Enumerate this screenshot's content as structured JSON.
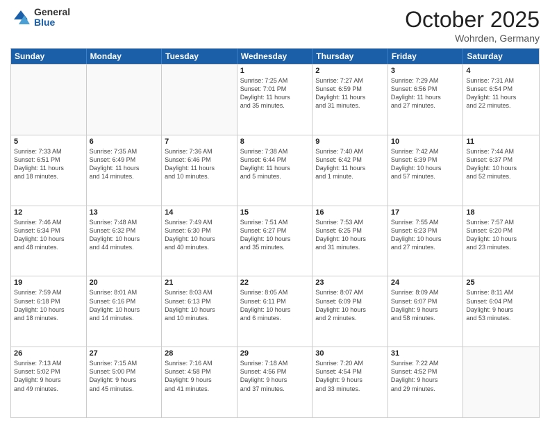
{
  "logo": {
    "general": "General",
    "blue": "Blue"
  },
  "header": {
    "month": "October 2025",
    "location": "Wohrden, Germany"
  },
  "weekdays": [
    "Sunday",
    "Monday",
    "Tuesday",
    "Wednesday",
    "Thursday",
    "Friday",
    "Saturday"
  ],
  "rows": [
    [
      {
        "day": "",
        "info": ""
      },
      {
        "day": "",
        "info": ""
      },
      {
        "day": "",
        "info": ""
      },
      {
        "day": "1",
        "info": "Sunrise: 7:25 AM\nSunset: 7:01 PM\nDaylight: 11 hours\nand 35 minutes."
      },
      {
        "day": "2",
        "info": "Sunrise: 7:27 AM\nSunset: 6:59 PM\nDaylight: 11 hours\nand 31 minutes."
      },
      {
        "day": "3",
        "info": "Sunrise: 7:29 AM\nSunset: 6:56 PM\nDaylight: 11 hours\nand 27 minutes."
      },
      {
        "day": "4",
        "info": "Sunrise: 7:31 AM\nSunset: 6:54 PM\nDaylight: 11 hours\nand 22 minutes."
      }
    ],
    [
      {
        "day": "5",
        "info": "Sunrise: 7:33 AM\nSunset: 6:51 PM\nDaylight: 11 hours\nand 18 minutes."
      },
      {
        "day": "6",
        "info": "Sunrise: 7:35 AM\nSunset: 6:49 PM\nDaylight: 11 hours\nand 14 minutes."
      },
      {
        "day": "7",
        "info": "Sunrise: 7:36 AM\nSunset: 6:46 PM\nDaylight: 11 hours\nand 10 minutes."
      },
      {
        "day": "8",
        "info": "Sunrise: 7:38 AM\nSunset: 6:44 PM\nDaylight: 11 hours\nand 5 minutes."
      },
      {
        "day": "9",
        "info": "Sunrise: 7:40 AM\nSunset: 6:42 PM\nDaylight: 11 hours\nand 1 minute."
      },
      {
        "day": "10",
        "info": "Sunrise: 7:42 AM\nSunset: 6:39 PM\nDaylight: 10 hours\nand 57 minutes."
      },
      {
        "day": "11",
        "info": "Sunrise: 7:44 AM\nSunset: 6:37 PM\nDaylight: 10 hours\nand 52 minutes."
      }
    ],
    [
      {
        "day": "12",
        "info": "Sunrise: 7:46 AM\nSunset: 6:34 PM\nDaylight: 10 hours\nand 48 minutes."
      },
      {
        "day": "13",
        "info": "Sunrise: 7:48 AM\nSunset: 6:32 PM\nDaylight: 10 hours\nand 44 minutes."
      },
      {
        "day": "14",
        "info": "Sunrise: 7:49 AM\nSunset: 6:30 PM\nDaylight: 10 hours\nand 40 minutes."
      },
      {
        "day": "15",
        "info": "Sunrise: 7:51 AM\nSunset: 6:27 PM\nDaylight: 10 hours\nand 35 minutes."
      },
      {
        "day": "16",
        "info": "Sunrise: 7:53 AM\nSunset: 6:25 PM\nDaylight: 10 hours\nand 31 minutes."
      },
      {
        "day": "17",
        "info": "Sunrise: 7:55 AM\nSunset: 6:23 PM\nDaylight: 10 hours\nand 27 minutes."
      },
      {
        "day": "18",
        "info": "Sunrise: 7:57 AM\nSunset: 6:20 PM\nDaylight: 10 hours\nand 23 minutes."
      }
    ],
    [
      {
        "day": "19",
        "info": "Sunrise: 7:59 AM\nSunset: 6:18 PM\nDaylight: 10 hours\nand 18 minutes."
      },
      {
        "day": "20",
        "info": "Sunrise: 8:01 AM\nSunset: 6:16 PM\nDaylight: 10 hours\nand 14 minutes."
      },
      {
        "day": "21",
        "info": "Sunrise: 8:03 AM\nSunset: 6:13 PM\nDaylight: 10 hours\nand 10 minutes."
      },
      {
        "day": "22",
        "info": "Sunrise: 8:05 AM\nSunset: 6:11 PM\nDaylight: 10 hours\nand 6 minutes."
      },
      {
        "day": "23",
        "info": "Sunrise: 8:07 AM\nSunset: 6:09 PM\nDaylight: 10 hours\nand 2 minutes."
      },
      {
        "day": "24",
        "info": "Sunrise: 8:09 AM\nSunset: 6:07 PM\nDaylight: 9 hours\nand 58 minutes."
      },
      {
        "day": "25",
        "info": "Sunrise: 8:11 AM\nSunset: 6:04 PM\nDaylight: 9 hours\nand 53 minutes."
      }
    ],
    [
      {
        "day": "26",
        "info": "Sunrise: 7:13 AM\nSunset: 5:02 PM\nDaylight: 9 hours\nand 49 minutes."
      },
      {
        "day": "27",
        "info": "Sunrise: 7:15 AM\nSunset: 5:00 PM\nDaylight: 9 hours\nand 45 minutes."
      },
      {
        "day": "28",
        "info": "Sunrise: 7:16 AM\nSunset: 4:58 PM\nDaylight: 9 hours\nand 41 minutes."
      },
      {
        "day": "29",
        "info": "Sunrise: 7:18 AM\nSunset: 4:56 PM\nDaylight: 9 hours\nand 37 minutes."
      },
      {
        "day": "30",
        "info": "Sunrise: 7:20 AM\nSunset: 4:54 PM\nDaylight: 9 hours\nand 33 minutes."
      },
      {
        "day": "31",
        "info": "Sunrise: 7:22 AM\nSunset: 4:52 PM\nDaylight: 9 hours\nand 29 minutes."
      },
      {
        "day": "",
        "info": ""
      }
    ]
  ]
}
